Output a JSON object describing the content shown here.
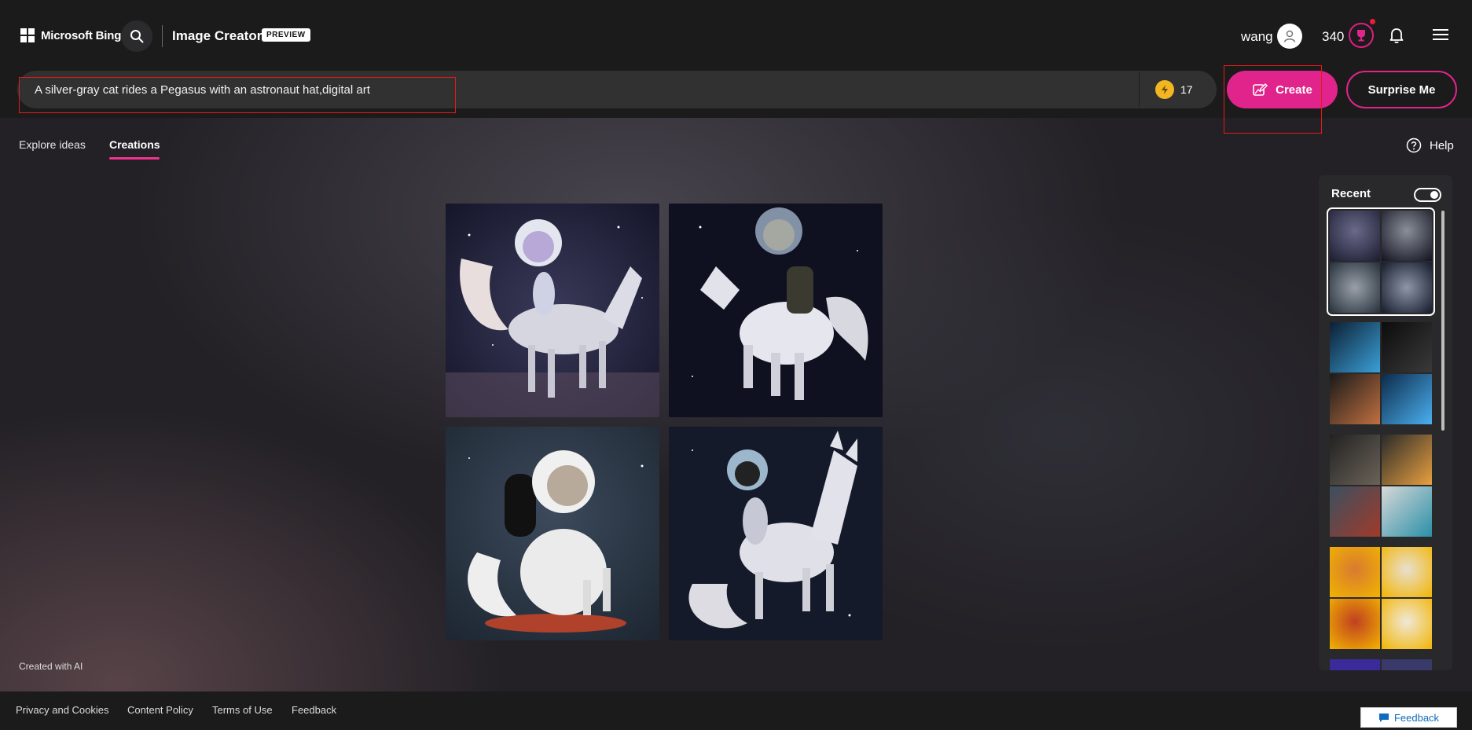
{
  "header": {
    "logo_text": "Microsoft Bing",
    "app_title": "Image Creator",
    "badge": "PREVIEW",
    "user_name": "wang",
    "points": "340"
  },
  "prompt": {
    "value": "A silver-gray cat rides a Pegasus with an astronaut hat,digital art",
    "boosts": "17",
    "create_label": "Create",
    "surprise_label": "Surprise Me"
  },
  "tabs": [
    {
      "label": "Explore ideas"
    },
    {
      "label": "Creations"
    }
  ],
  "help_label": "Help",
  "created_with_ai": "Created with AI",
  "recent": {
    "title": "Recent",
    "toggle_on": true
  },
  "footer": {
    "links": [
      "Privacy and Cookies",
      "Content Policy",
      "Terms of Use",
      "Feedback"
    ],
    "feedback_button": "Feedback"
  },
  "colors": {
    "accent": "#e0248b",
    "highlight_box": "#e41b1b",
    "boost_coin": "#f2b622"
  }
}
